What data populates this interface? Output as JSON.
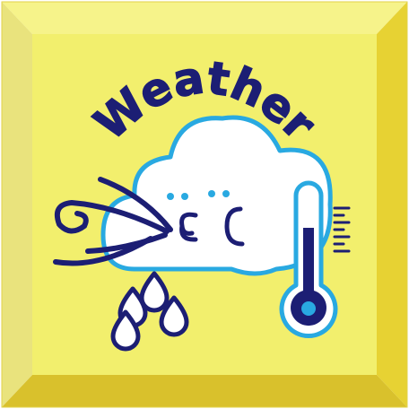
{
  "app_icon": {
    "title": "Weather",
    "icons": [
      "cloud-face-icon",
      "wind-icon",
      "raindrops-icon",
      "thermometer-icon"
    ]
  },
  "colors": {
    "frame_face": "#f2ef6d",
    "frame_top": "#f6f38a",
    "frame_left": "#e9e37d",
    "frame_right": "#e7d233",
    "frame_bottom": "#d9c12c",
    "ink": "#1c1e74",
    "cloud_outline": "#29a9e1",
    "cloud_fill": "#ffffff"
  }
}
